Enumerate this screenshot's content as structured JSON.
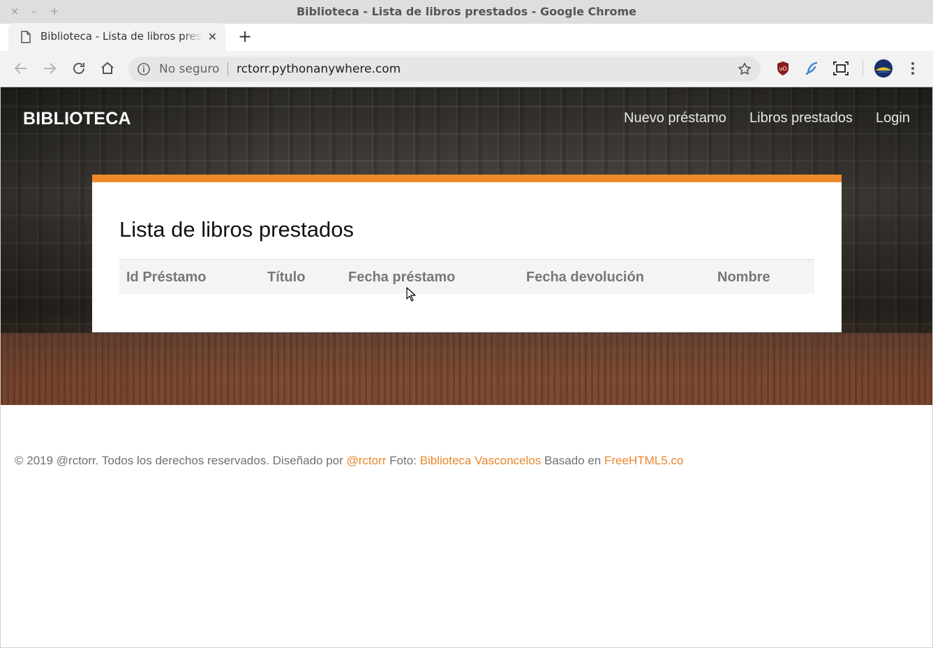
{
  "window": {
    "title": "Biblioteca - Lista de libros prestados - Google Chrome",
    "close": "×",
    "minimize": "–",
    "maximize": "+"
  },
  "tab": {
    "title": "Biblioteca - Lista de libros prestados",
    "close": "✕",
    "new_tab": "+"
  },
  "address_bar": {
    "security_label": "No seguro",
    "url": "rctorr.pythonanywhere.com"
  },
  "site": {
    "brand": "BIBLIOTECA",
    "nav": [
      "Nuevo préstamo",
      "Libros prestados",
      "Login"
    ]
  },
  "main": {
    "title": "Lista de libros prestados",
    "columns": [
      "Id Préstamo",
      "Título",
      "Fecha préstamo",
      "Fecha devolución",
      "Nombre"
    ],
    "rows": []
  },
  "footer": {
    "prefix": "© 2019 @rctorr. Todos los derechos reservados. Diseñado por",
    "designer_link": "@rctorr",
    "photo_label": "Foto:",
    "photo_link": "Biblioteca Vasconcelos",
    "based_label": "Basado en",
    "based_link": "FreeHTML5.co"
  },
  "colors": {
    "accent": "#ef8a2a",
    "link": "#e8852b"
  },
  "icons": [
    "page-icon",
    "back-icon",
    "forward-icon",
    "reload-icon",
    "home-icon",
    "info-icon",
    "star-icon",
    "ublock-icon",
    "feather-icon",
    "screenshot-icon",
    "profile-avatar",
    "menu-icon",
    "cursor-icon"
  ]
}
